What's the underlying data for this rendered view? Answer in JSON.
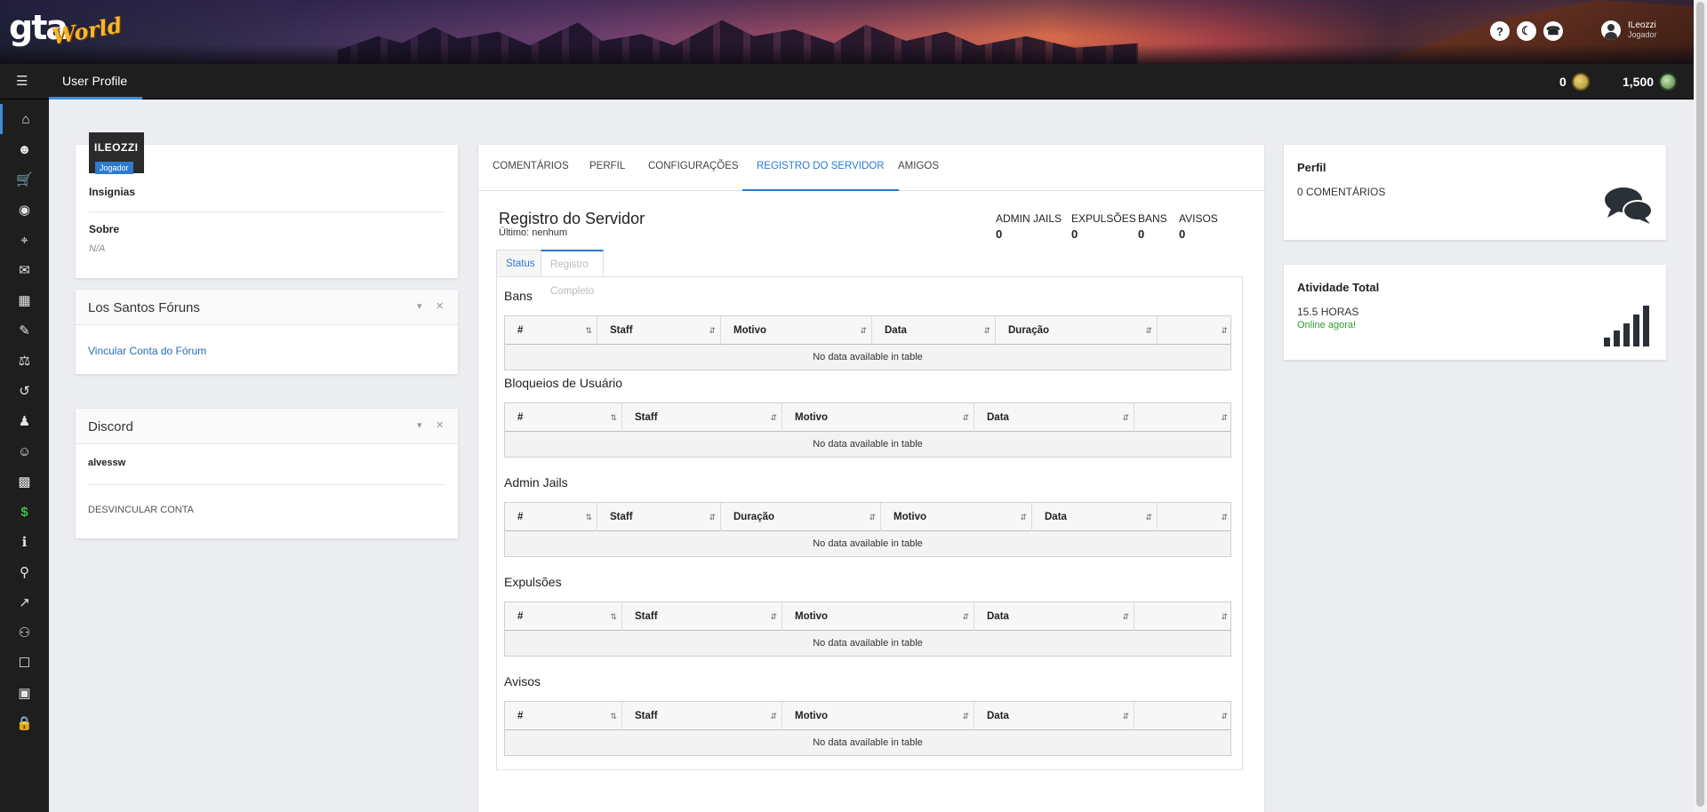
{
  "header": {
    "logo_main": "gta",
    "logo_sub": "World",
    "icons": [
      "question-icon",
      "moon-icon",
      "bell-icon"
    ],
    "user": {
      "name": "ILeozzi",
      "role": "Jogador"
    }
  },
  "topbar": {
    "title": "User Profile",
    "currencies": [
      {
        "value": "0",
        "icon": "gold-coin-icon"
      },
      {
        "value": "1,500",
        "icon": "green-coin-icon"
      }
    ]
  },
  "sidebar": {
    "items": [
      "home-icon",
      "user-icon",
      "cart-icon",
      "mask-icon",
      "broadcast-icon",
      "comments-icon",
      "building-icon",
      "brush-icon",
      "balance-scale-icon",
      "undo-icon",
      "user-tie-icon",
      "smile-icon",
      "id-card-icon",
      "dollar-icon",
      "info-icon",
      "map-marker-icon",
      "external-link-icon",
      "users-icon",
      "chat-bubbles-icon",
      "message-icon",
      "lock-icon"
    ]
  },
  "profile": {
    "name": "ILEOZZI",
    "role": "Jogador",
    "insignias_label": "Insignias",
    "about_label": "Sobre",
    "about_value": "N/A"
  },
  "forums_widget": {
    "title": "Los Santos Fóruns",
    "link": "Vincular Conta do Fórum"
  },
  "discord_widget": {
    "title": "Discord",
    "username": "alvessw",
    "unlink": "DESVINCULAR CONTA"
  },
  "tabs": [
    "COMENTÁRIOS",
    "PERFIL",
    "CONFIGURAÇÕES",
    "REGISTRO DO SERVIDOR",
    "AMIGOS"
  ],
  "server_log": {
    "title": "Registro do Servidor",
    "last": "Último: nenhum",
    "stats": [
      {
        "label": "ADMIN JAILS",
        "value": "0"
      },
      {
        "label": "EXPULSÕES",
        "value": "0"
      },
      {
        "label": "BANS",
        "value": "0"
      },
      {
        "label": "AVISOS",
        "value": "0"
      }
    ],
    "subtabs": [
      "Status",
      "Registro Completo"
    ],
    "empty_text": "No data available in table",
    "tables": [
      {
        "title": "Bans",
        "columns": [
          "#",
          "Staff",
          "Motivo",
          "Data",
          "Duração",
          ""
        ]
      },
      {
        "title": "Bloqueios de Usuário",
        "columns": [
          "#",
          "Staff",
          "Motivo",
          "Data",
          ""
        ]
      },
      {
        "title": "Admin Jails",
        "columns": [
          "#",
          "Staff",
          "Duração",
          "Motivo",
          "Data",
          ""
        ]
      },
      {
        "title": "Expulsões",
        "columns": [
          "#",
          "Staff",
          "Motivo",
          "Data",
          ""
        ]
      },
      {
        "title": "Avisos",
        "columns": [
          "#",
          "Staff",
          "Motivo",
          "Data",
          ""
        ]
      }
    ]
  },
  "perfil_card": {
    "title": "Perfil",
    "value": "0 COMENTÁRIOS"
  },
  "activity_card": {
    "title": "Atividade Total",
    "value": "15.5 HORAS",
    "status": "Online agora!"
  }
}
